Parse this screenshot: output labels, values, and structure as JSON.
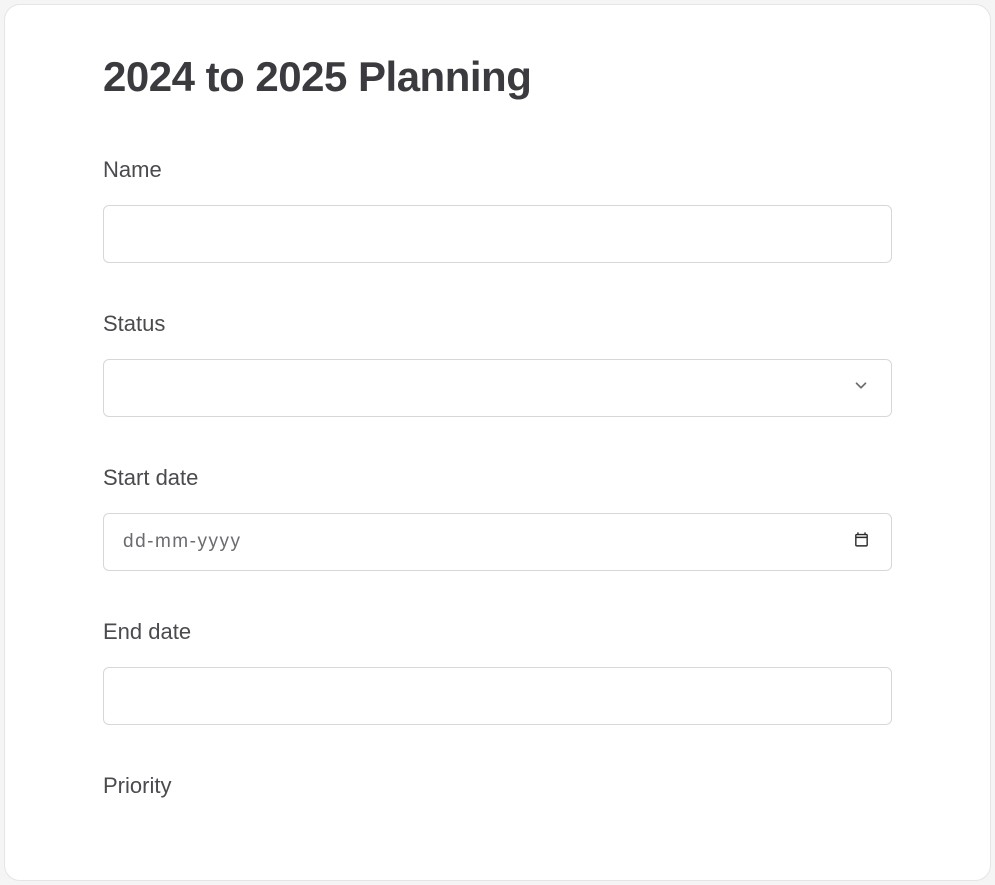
{
  "form": {
    "title": "2024 to 2025 Planning",
    "fields": {
      "name": {
        "label": "Name",
        "value": ""
      },
      "status": {
        "label": "Status",
        "value": ""
      },
      "start_date": {
        "label": "Start date",
        "placeholder": "dd-mm-yyyy",
        "value": ""
      },
      "end_date": {
        "label": "End date",
        "value": ""
      },
      "priority": {
        "label": "Priority"
      }
    }
  }
}
